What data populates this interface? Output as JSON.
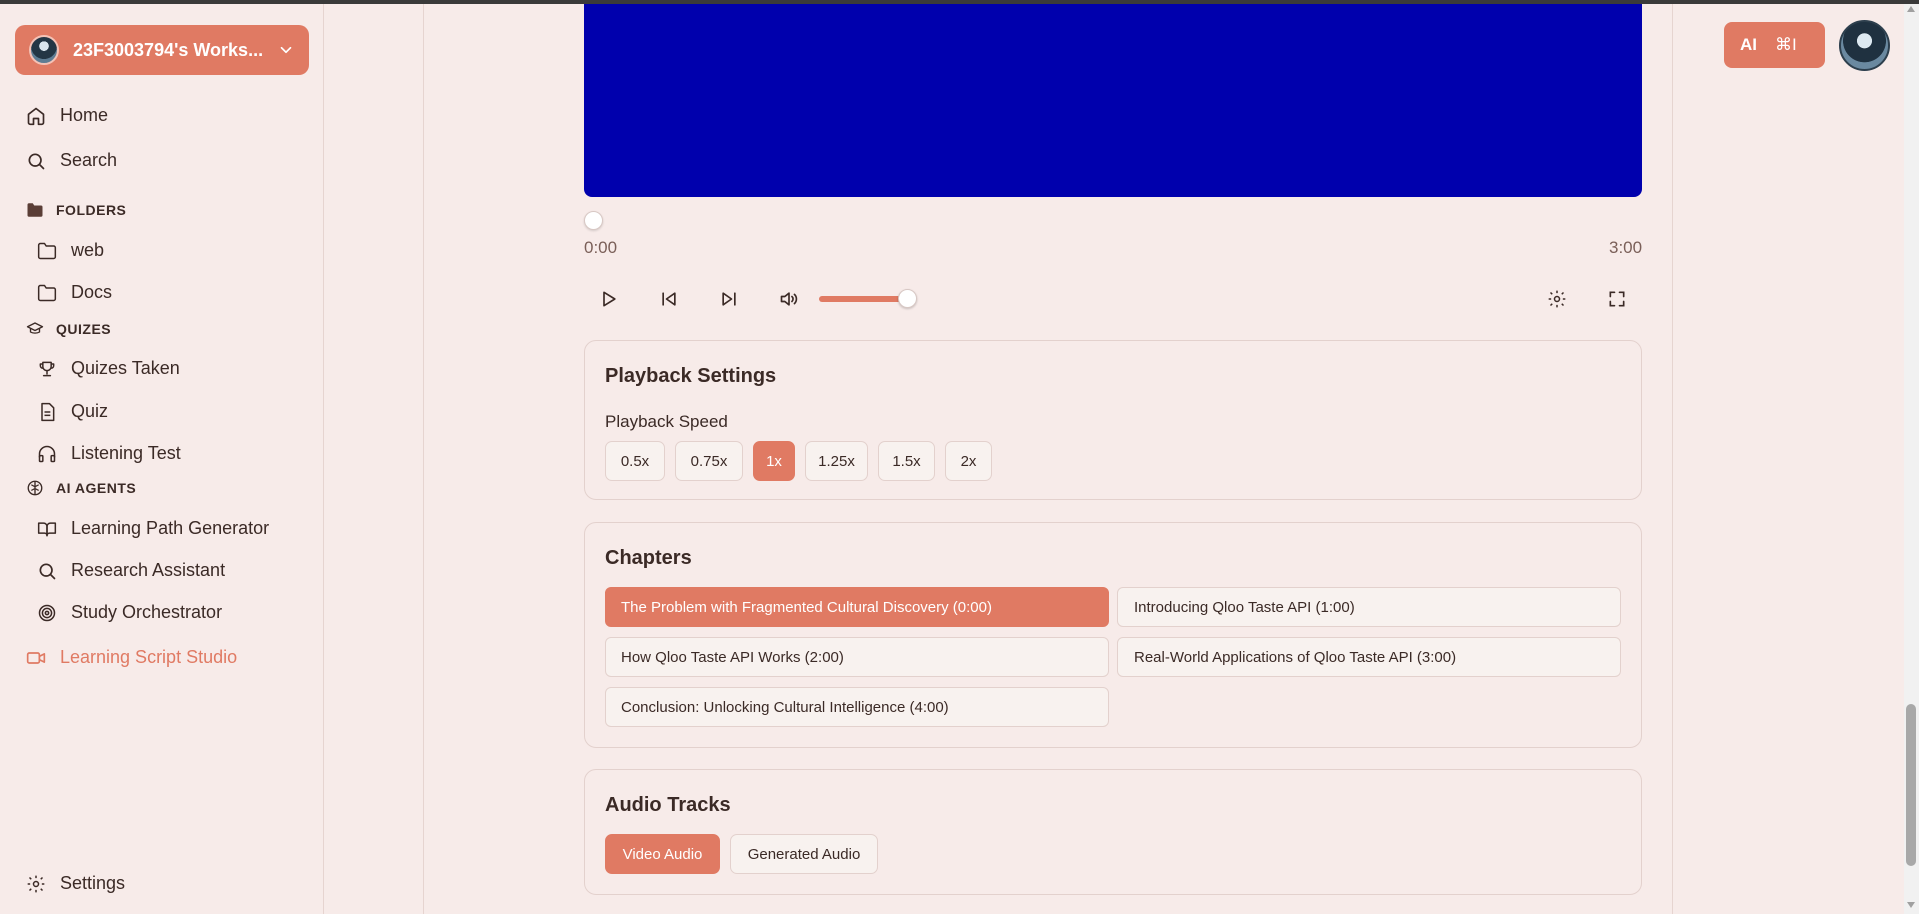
{
  "workspace": {
    "name": "23F3003794's Works..."
  },
  "nav": {
    "home": "Home",
    "search": "Search",
    "settings": "Settings"
  },
  "sections": {
    "folders": {
      "label": "FOLDERS",
      "items": [
        "web",
        "Docs"
      ]
    },
    "quizes": {
      "label": "QUIZES",
      "items": [
        "Quizes Taken",
        "Quiz",
        "Listening Test"
      ]
    },
    "ai_agents": {
      "label": "AI AGENTS",
      "items": [
        "Learning Path Generator",
        "Research Assistant",
        "Study Orchestrator"
      ]
    },
    "studio": "Learning Script Studio"
  },
  "player": {
    "current_time": "0:00",
    "duration": "3:00",
    "video_color": "#0000ad",
    "volume_fraction": 0.9,
    "progress_fraction": 0.0
  },
  "playback_settings": {
    "title": "Playback Settings",
    "speed_label": "Playback Speed",
    "speeds": [
      "0.5x",
      "0.75x",
      "1x",
      "1.25x",
      "1.5x",
      "2x"
    ],
    "selected_speed": "1x"
  },
  "chapters": {
    "title": "Chapters",
    "items": [
      "The Problem with Fragmented Cultural Discovery (0:00)",
      "Introducing Qloo Taste API (1:00)",
      "How Qloo Taste API Works (2:00)",
      "Real-World Applications of Qloo Taste API (3:00)",
      "Conclusion: Unlocking Cultural Intelligence (4:00)"
    ],
    "active_index": 0
  },
  "audio_tracks": {
    "title": "Audio Tracks",
    "items": [
      "Video Audio",
      "Generated Audio"
    ],
    "selected": "Video Audio"
  },
  "topbar": {
    "ai_label": "AI",
    "shortcut": "⌘I"
  },
  "colors": {
    "accent": "#e07a63",
    "background": "#f7ebe9",
    "text": "#3b2a26"
  }
}
